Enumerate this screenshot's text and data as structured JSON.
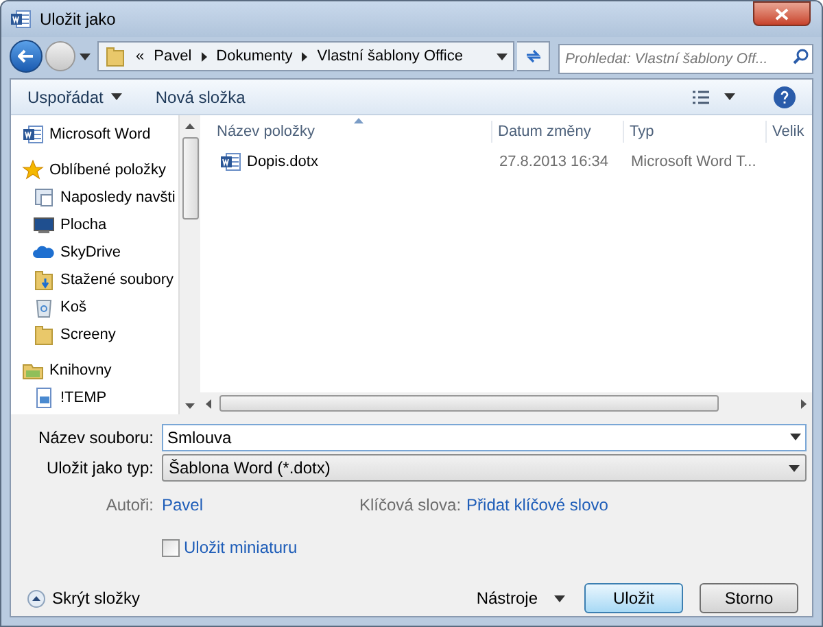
{
  "window": {
    "title": "Uložit jako"
  },
  "address": {
    "crumbs": [
      "«",
      "Pavel",
      "Dokumenty",
      "Vlastní šablony Office"
    ],
    "search_placeholder": "Prohledat: Vlastní šablony Off..."
  },
  "toolbar": {
    "organize": "Uspořádat",
    "new_folder": "Nová složka"
  },
  "nav": [
    {
      "label": "Microsoft Word",
      "kind": "word"
    },
    {
      "label": "Oblíbené položky",
      "kind": "star",
      "children": [
        {
          "label": "Naposledy navšti",
          "kind": "recent"
        },
        {
          "label": "Plocha",
          "kind": "desktop"
        },
        {
          "label": "SkyDrive",
          "kind": "cloud"
        },
        {
          "label": "Stažené soubory",
          "kind": "downloads"
        },
        {
          "label": "Koš",
          "kind": "trash"
        },
        {
          "label": "Screeny",
          "kind": "folder"
        }
      ]
    },
    {
      "label": "Knihovny",
      "kind": "library",
      "children": [
        {
          "label": "!TEMP",
          "kind": "document"
        }
      ]
    }
  ],
  "table": {
    "columns": [
      "Název položky",
      "Datum změny",
      "Typ",
      "Velik"
    ],
    "rows": [
      {
        "name": "Dopis.dotx",
        "date": "27.8.2013 16:34",
        "type": "Microsoft Word T...",
        "selected": false
      }
    ]
  },
  "form": {
    "filename_label": "Název souboru:",
    "filename": "Smlouva",
    "type_label": "Uložit jako typ:",
    "type": "Šablona Word (*.dotx)",
    "authors_label": "Autoři:",
    "authors": "Pavel",
    "keywords_label": "Klíčová slova:",
    "keywords": "Přidat klíčové slovo",
    "thumbnail": {
      "label": "Uložit miniaturu",
      "checked": false
    }
  },
  "footer": {
    "hide_folders": "Skrýt složky",
    "tools": "Nástroje",
    "save": "Uložit",
    "cancel": "Storno"
  }
}
